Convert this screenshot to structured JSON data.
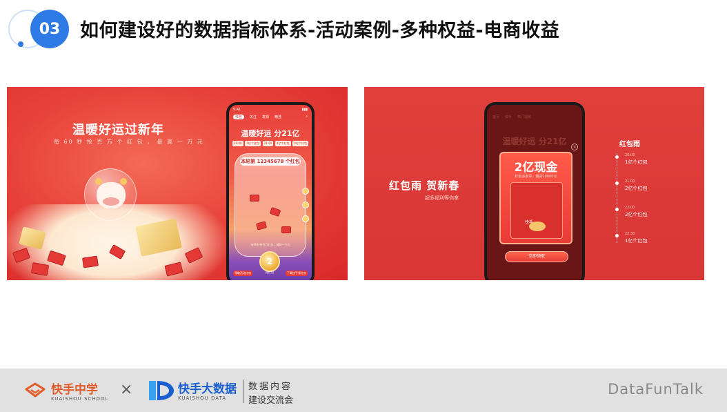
{
  "header": {
    "badge": "03",
    "title": "如何建设好的数据指标体系-活动案例-多种权益-电商收益"
  },
  "left_panel": {
    "banner_title": "温暖好运过新年",
    "banner_subtitle": "每 60 秒 抢 百 万 个 红 包 ， 最 高 一 万 元",
    "phone": {
      "time": "9:41",
      "tabs": [
        "红包",
        "关注",
        "发现",
        "精选"
      ],
      "title": "温暖好运 分21亿",
      "chips": [
        "20:00",
        "4亿个红包",
        "21:00",
        "4亿个红包",
        "4亿个红包"
      ],
      "counter": "本轮第 12345678 个红包",
      "jar_message": "每60秒抢百万红包，最高一万元",
      "coin_value": "2",
      "coin_label": "抢红包",
      "btn_left": "领取活动红包",
      "btn_right": "下载快手领红包"
    }
  },
  "right_panel": {
    "title": "红包雨 贺新春",
    "subtitle": "超多福利等你拿",
    "phone": {
      "dim_tabs": [
        "首页",
        "快手",
        "热门视频"
      ],
      "dim_title": "温暖好运 分21亿",
      "close": "×",
      "popup_title": "2亿现金",
      "popup_subtitle": "红包派发中，最高10000元",
      "popup_brand": "快手",
      "claim_button": "立即领取"
    },
    "timeline": {
      "title": "红包雨",
      "items": [
        {
          "time": "20:00",
          "label": "1亿个红包"
        },
        {
          "time": "21:00",
          "label": "2亿个红包"
        },
        {
          "time": "22:00",
          "label": "2亿个红包"
        },
        {
          "time": "22:30",
          "label": "1亿个红包"
        }
      ]
    }
  },
  "footer": {
    "ks_name": "快手中学",
    "ks_sub": "KUAISHOU SCHOOL",
    "times": "×",
    "kd_name": "快手大数据",
    "kd_sub": "KUAISHOU DATA",
    "kd_tag1": "数据内容",
    "kd_tag2": "建设交流会",
    "brand_right": "DataFunTalk"
  },
  "colors": {
    "accent_blue": "#2f7be6",
    "banner_red": "#e8433a",
    "footer_gray": "#e1e1e1",
    "ks_orange": "#e25b2a",
    "kd_blue": "#1a5fd0"
  }
}
